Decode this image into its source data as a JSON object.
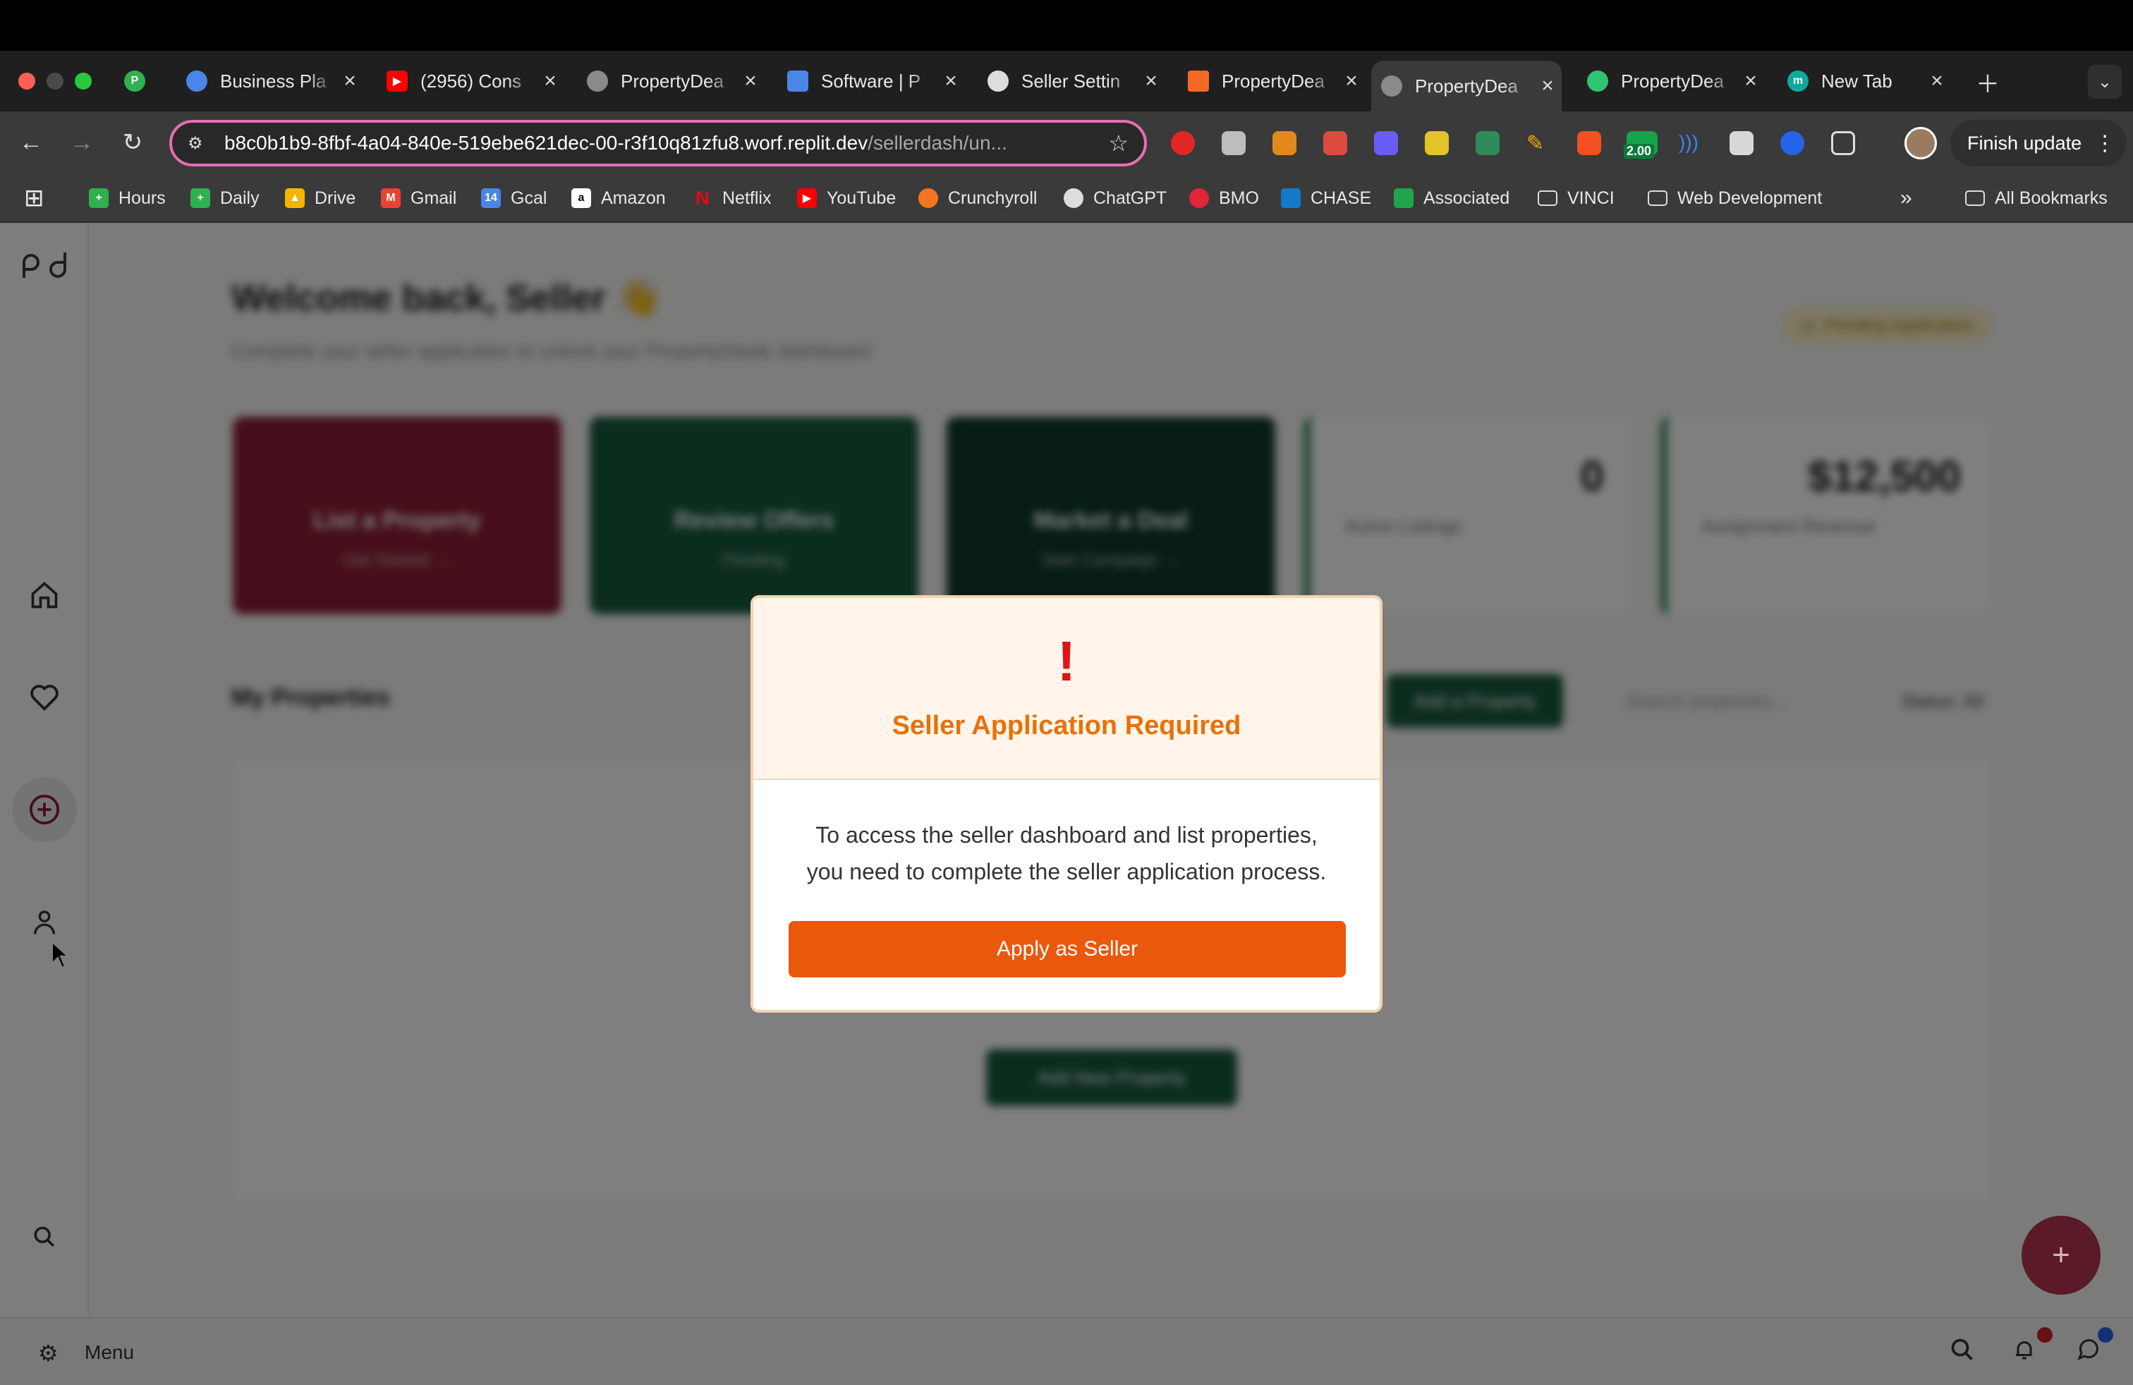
{
  "browser": {
    "tabs": [
      {
        "title": "",
        "favicon": "P",
        "color": "#2fb14f"
      },
      {
        "title": "Business Pla",
        "color": "#4a86e8"
      },
      {
        "title": "(2956) Cons",
        "color": "#ff0000"
      },
      {
        "title": "PropertyDea",
        "color": "#8a8a8a"
      },
      {
        "title": "Software | P",
        "color": "#4a86e8"
      },
      {
        "title": "Seller Settin",
        "color": "#dddddd"
      },
      {
        "title": "PropertyDea",
        "color": "#f26a22"
      },
      {
        "title": "PropertyDea",
        "color": "#8a8a8a"
      },
      {
        "title": "PropertyDea",
        "color": "#2fc471"
      },
      {
        "title": "New Tab",
        "favicon": "m",
        "color": "#13a89e"
      }
    ],
    "url_main": "b8c0b1b9-8fbf-4a04-840e-519ebe621dec-00-r3f10q81zfu8.worf.replit.dev",
    "url_path": "/sellerdash/un...",
    "finish_update": "Finish update",
    "extension_badge": "2.00",
    "bookmarks": [
      {
        "label": "Hours",
        "color": "#2fb14f"
      },
      {
        "label": "Daily",
        "color": "#2fb14f"
      },
      {
        "label": "Drive",
        "color": "#f4b400"
      },
      {
        "label": "Gmail",
        "color": "#ea4335"
      },
      {
        "label": "Gcal",
        "color": "#4a86e8"
      },
      {
        "label": "Amazon",
        "color": "#ffffff"
      },
      {
        "label": "Netflix",
        "color": "#e50914"
      },
      {
        "label": "YouTube",
        "color": "#ff0000"
      },
      {
        "label": "Crunchyroll",
        "color": "#f47521"
      },
      {
        "label": "ChatGPT",
        "color": "#dddddd"
      },
      {
        "label": "BMO",
        "color": "#e0263a"
      },
      {
        "label": "CHASE",
        "color": "#117aca"
      },
      {
        "label": "Associated",
        "color": "#21a54b"
      },
      {
        "label": "VINCI",
        "color": "folder"
      },
      {
        "label": "Web Development",
        "color": "folder"
      }
    ],
    "all_bookmarks": "All Bookmarks"
  },
  "page": {
    "welcome": "Welcome back, Seller 👋",
    "subtitle": "Complete your seller application to unlock your PropertyDeals dashboard",
    "pending_badge": "Pending Application",
    "cards": [
      {
        "title": "List a Property",
        "sub": "Get Started →",
        "color": "#8c1d34"
      },
      {
        "title": "Review Offers",
        "sub": "Pending",
        "color": "#175a3c"
      },
      {
        "title": "Market a Deal",
        "sub": "Start Campaign →",
        "color": "#0e3b28"
      }
    ],
    "stats": [
      {
        "value": "0",
        "label": "Active Listings"
      },
      {
        "value": "$12,500",
        "label": "Assignment Revenue"
      }
    ],
    "my_properties": "My Properties",
    "add_property": "Add a Property",
    "search_placeholder": "Search properties...",
    "status_filter": "Status: All",
    "add_new_property": "Add New Property"
  },
  "modal": {
    "icon": "!",
    "title": "Seller Application Required",
    "body": "To access the seller dashboard and list properties, you need to complete the seller application process.",
    "button": "Apply as Seller"
  },
  "bottombar": {
    "menu_label": "Menu"
  },
  "colors": {
    "accent_orange": "#ea580c",
    "title_orange": "#e8710a",
    "alert_red": "#e01414",
    "brand_maroon": "#8c1d34"
  }
}
